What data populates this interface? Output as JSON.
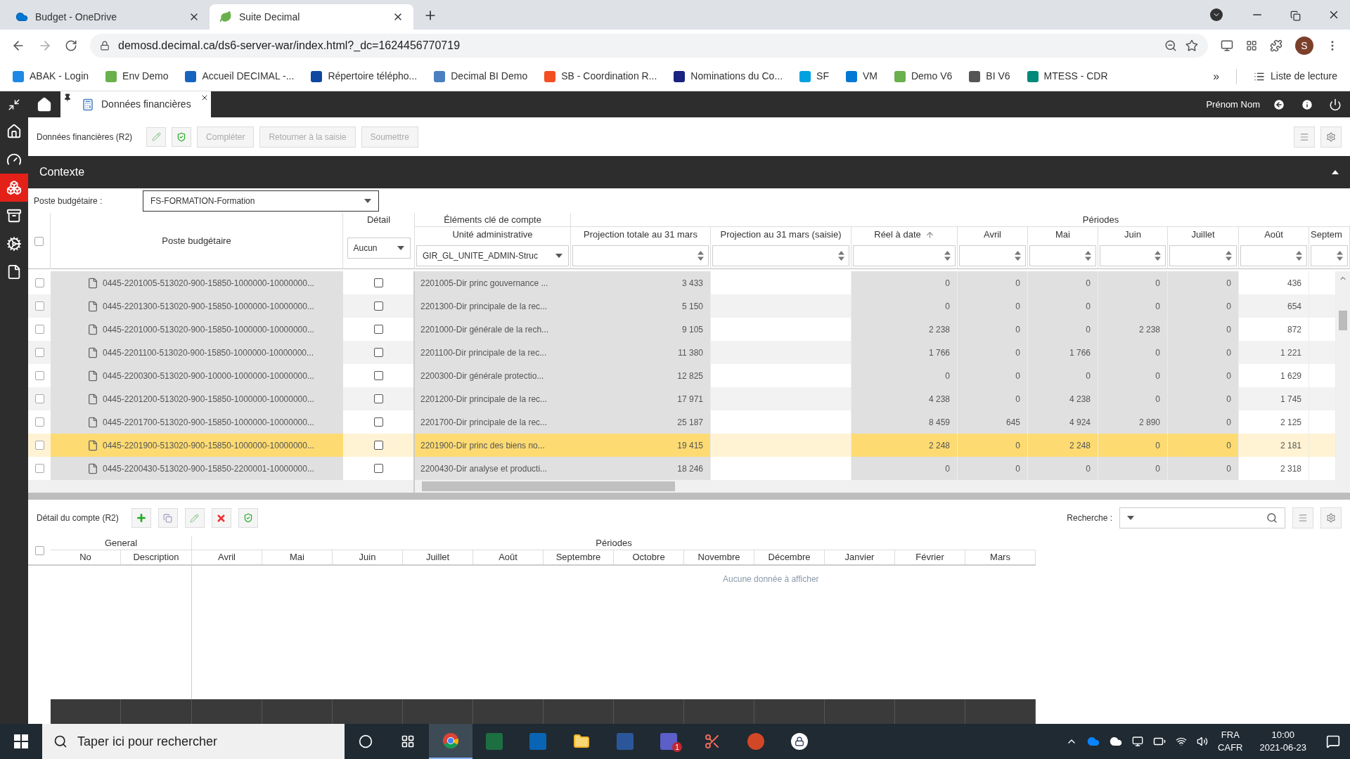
{
  "browser": {
    "tabs": [
      {
        "title": "Budget - OneDrive",
        "kind": "cloud",
        "selected": false
      },
      {
        "title": "Suite Decimal",
        "kind": "leaf",
        "selected": true
      }
    ],
    "address": "demosd.decimal.ca/ds6-server-war/index.html?_dc=1624456770719",
    "profile": "S",
    "bookmarks": [
      {
        "label": "ABAK - Login",
        "color": "#1e88e5"
      },
      {
        "label": "Env Demo",
        "color": "#6ab04c"
      },
      {
        "label": "Accueil DECIMAL -...",
        "color": "#1565c0"
      },
      {
        "label": "Répertoire télépho...",
        "color": "#0d47a1"
      },
      {
        "label": "Decimal BI Demo",
        "color": "#4a7fc1"
      },
      {
        "label": "SB - Coordination R...",
        "color": "#f25022"
      },
      {
        "label": "Nominations du Co...",
        "color": "#1a237e"
      },
      {
        "label": "SF",
        "color": "#00a1e0"
      },
      {
        "label": "VM",
        "color": "#0078d4"
      },
      {
        "label": "Demo V6",
        "color": "#6ab04c"
      },
      {
        "label": "BI V6",
        "color": "#555555"
      },
      {
        "label": "MTESS - CDR",
        "color": "#00897b"
      }
    ],
    "overflow": "»",
    "reading_list": "Liste de lecture"
  },
  "app": {
    "tab": "Données financières",
    "user": "Prénom Nom",
    "sidebar": [
      {
        "kind": "home",
        "selected": false
      },
      {
        "kind": "gauge",
        "selected": false
      },
      {
        "kind": "boxes",
        "selected": true
      },
      {
        "kind": "archive",
        "selected": false
      },
      {
        "kind": "cogs",
        "selected": false
      },
      {
        "kind": "file",
        "selected": false
      }
    ]
  },
  "toolbar": {
    "title": "Données financières (R2)",
    "buttons": [
      {
        "label": "Compléter",
        "disabled": true
      },
      {
        "label": "Retourner à la saisie",
        "disabled": true
      },
      {
        "label": "Soumettre",
        "disabled": true
      }
    ]
  },
  "context": {
    "title": "Contexte",
    "expanded": true,
    "filter_label": "Poste budgétaire :",
    "filter_value": "FS-FORMATION-Formation"
  },
  "grid": {
    "select_all_checked": false,
    "account_header": "Poste budgétaire",
    "detail_header": "Détail",
    "detail_filter": "Aucun",
    "key_group": "Éléments clé de compte",
    "periods_group": "Périodes",
    "unit_header": "Unité administrative",
    "unit_filter": "GIR_GL_UNITE_ADMIN-Struc",
    "columns": [
      {
        "label": "Projection totale au 31 mars",
        "kind": "number",
        "editable": false,
        "sorted": false
      },
      {
        "label": "Projection au 31 mars (saisie)",
        "kind": "entry",
        "editable": true,
        "sorted": false
      },
      {
        "label": "Réel à date",
        "kind": "number",
        "editable": false,
        "sorted": true
      },
      {
        "label": "Avril",
        "kind": "number",
        "editable": false,
        "sorted": false
      },
      {
        "label": "Mai",
        "kind": "number",
        "editable": false,
        "sorted": false
      },
      {
        "label": "Juin",
        "kind": "number",
        "editable": false,
        "sorted": false
      },
      {
        "label": "Juillet",
        "kind": "number",
        "editable": false,
        "sorted": false
      },
      {
        "label": "Août",
        "kind": "number",
        "editable": true,
        "sorted": false
      },
      {
        "label": "Septem",
        "kind": "entry",
        "editable": true,
        "sorted": false
      }
    ],
    "rows": [
      {
        "checked": false,
        "detail_checked": false,
        "account": "0445-2201005-513020-900-15850-1000000-10000000...",
        "unit": "2201005-Dir princ gouvernance ...",
        "selected": false,
        "values": [
          "3 433",
          "0",
          "0",
          "0",
          "0",
          "0",
          "436"
        ]
      },
      {
        "checked": false,
        "detail_checked": false,
        "account": "0445-2201300-513020-900-15850-1000000-10000000...",
        "unit": "2201300-Dir principale de la rec...",
        "selected": false,
        "values": [
          "5 150",
          "0",
          "0",
          "0",
          "0",
          "0",
          "654"
        ]
      },
      {
        "checked": false,
        "detail_checked": false,
        "account": "0445-2201000-513020-900-15850-1000000-10000000...",
        "unit": "2201000-Dir générale de la rech...",
        "selected": false,
        "values": [
          "9 105",
          "2 238",
          "0",
          "0",
          "2 238",
          "0",
          "872"
        ]
      },
      {
        "checked": false,
        "detail_checked": false,
        "account": "0445-2201100-513020-900-15850-1000000-10000000...",
        "unit": "2201100-Dir principale de la rec...",
        "selected": false,
        "values": [
          "11 380",
          "1 766",
          "0",
          "1 766",
          "0",
          "0",
          "1 221"
        ]
      },
      {
        "checked": false,
        "detail_checked": false,
        "account": "0445-2200300-513020-900-10000-1000000-10000000...",
        "unit": "2200300-Dir générale protectio...",
        "selected": false,
        "values": [
          "12 825",
          "0",
          "0",
          "0",
          "0",
          "0",
          "1 629"
        ]
      },
      {
        "checked": false,
        "detail_checked": false,
        "account": "0445-2201200-513020-900-15850-1000000-10000000...",
        "unit": "2201200-Dir principale de la rec...",
        "selected": false,
        "values": [
          "17 971",
          "4 238",
          "0",
          "4 238",
          "0",
          "0",
          "1 745"
        ]
      },
      {
        "checked": false,
        "detail_checked": false,
        "account": "0445-2201700-513020-900-15850-1000000-10000000...",
        "unit": "2201700-Dir principale de la rec...",
        "selected": false,
        "values": [
          "25 187",
          "8 459",
          "645",
          "4 924",
          "2 890",
          "0",
          "2 125"
        ]
      },
      {
        "checked": false,
        "detail_checked": false,
        "account": "0445-2201900-513020-900-15850-1000000-10000000...",
        "unit": "2201900-Dir princ des biens no...",
        "selected": true,
        "values": [
          "19 415",
          "2 248",
          "0",
          "2 248",
          "0",
          "0",
          "2 181"
        ]
      },
      {
        "checked": false,
        "detail_checked": false,
        "account": "0445-2200430-513020-900-15850-2200001-10000000...",
        "unit": "2200430-Dir analyse et producti...",
        "selected": false,
        "values": [
          "18 246",
          "0",
          "0",
          "0",
          "0",
          "0",
          "2 318"
        ]
      }
    ]
  },
  "detail": {
    "title": "Détail du compte (R2)",
    "search_label": "Recherche :",
    "select_all_checked": false,
    "general_group": "General",
    "periods_group": "Périodes",
    "general_columns": [
      "No",
      "Description"
    ],
    "period_columns": [
      "Avril",
      "Mai",
      "Juin",
      "Juillet",
      "Août",
      "Septembre",
      "Octobre",
      "Novembre",
      "Décembre",
      "Janvier",
      "Février",
      "Mars"
    ],
    "empty": "Aucune donnée à afficher"
  },
  "taskbar": {
    "search_placeholder": "Taper ici pour rechercher",
    "apps": [
      {
        "kind": "chrome",
        "selected": true
      },
      {
        "kind": "excel",
        "selected": false
      },
      {
        "kind": "outlook",
        "selected": false
      },
      {
        "kind": "folder",
        "selected": false
      },
      {
        "kind": "word",
        "selected": false
      },
      {
        "kind": "teams",
        "selected": false,
        "badge": "1"
      },
      {
        "kind": "snip",
        "selected": false
      },
      {
        "kind": "powerpoint",
        "selected": false
      },
      {
        "kind": "lock",
        "selected": false
      }
    ],
    "language": "FRA",
    "layout": "CAFR",
    "time": "10:00",
    "date": "2021-06-23"
  }
}
